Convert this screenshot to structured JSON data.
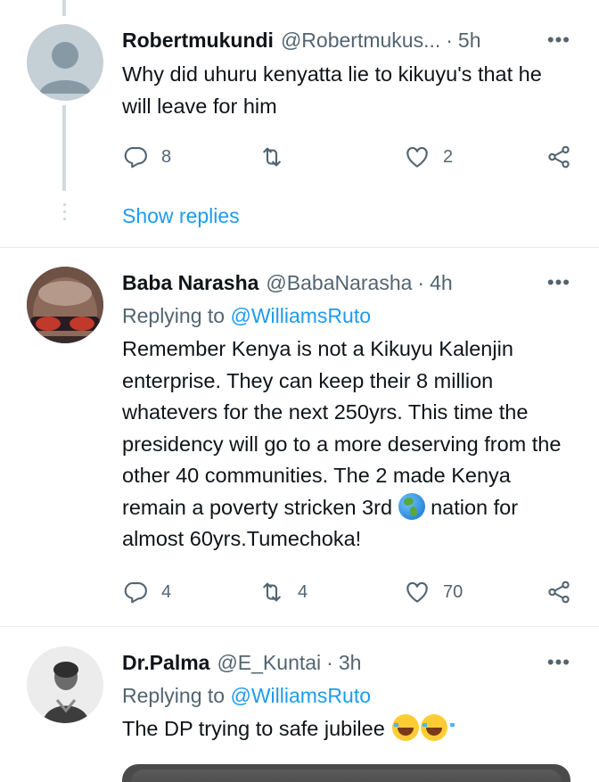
{
  "tweets": [
    {
      "name": "Robertmukundi",
      "handle": "@Robertmukus...",
      "separator": "·",
      "time": "5h",
      "text": "Why did uhuru kenyatta lie to kikuyu's that he will leave for him",
      "replies": "8",
      "retweets": "",
      "likes": "2",
      "show_replies": "Show replies"
    },
    {
      "name": "Baba Narasha",
      "handle": "@BabaNarasha",
      "separator": "·",
      "time": "4h",
      "replying_prefix": "Replying to",
      "replying_handle": "@WilliamsRuto",
      "text_before_emoji": "Remember Kenya is not a Kikuyu Kalenjin enterprise. They can keep their 8 million whatevers for the next 250yrs. This time the presidency will go to a more deserving from the other 40 communities. The 2 made Kenya remain a poverty stricken 3rd",
      "text_after_emoji": " nation for almost 60yrs.Tumechoka!",
      "replies": "4",
      "retweets": "4",
      "likes": "70"
    },
    {
      "name": "Dr.Palma",
      "handle": "@E_Kuntai",
      "separator": "·",
      "time": "3h",
      "replying_prefix": "Replying to",
      "replying_handle": "@WilliamsRuto",
      "text": "The DP trying to safe jubilee ",
      "replies": "",
      "retweets": "",
      "likes": ""
    }
  ],
  "more_glyph": "•••",
  "icons": {
    "reply": "reply-icon",
    "retweet": "retweet-icon",
    "like": "heart-icon",
    "share": "share-icon",
    "globe_emoji": "globe-emoji-icon",
    "laugh_emoji": "laughing-tears-emoji-icon"
  },
  "colors": {
    "link": "#1d9bf0",
    "secondary": "#536471",
    "line": "#cfd9de"
  }
}
